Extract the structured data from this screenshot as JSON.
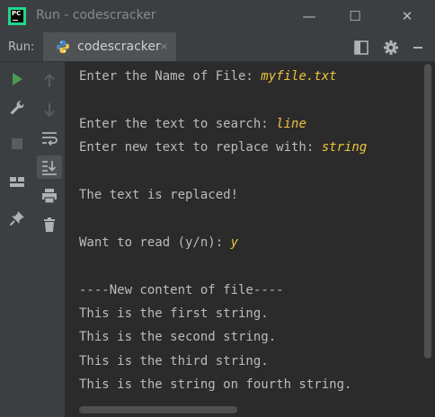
{
  "window": {
    "title": "Run - codescracker",
    "icon_text": "PC",
    "minimize": "—",
    "maximize": "☐",
    "close": "✕"
  },
  "run_panel": {
    "label": "Run:",
    "tab_label": "codescracker",
    "tab_close": "×"
  },
  "console": {
    "lines": [
      {
        "prompt": "Enter the Name of File: ",
        "input": "myfile.txt"
      },
      {
        "prompt": "",
        "input": ""
      },
      {
        "prompt": "Enter the text to search: ",
        "input": "line"
      },
      {
        "prompt": "Enter new text to replace with: ",
        "input": "string"
      },
      {
        "prompt": "",
        "input": ""
      },
      {
        "prompt": "The text is replaced!",
        "input": ""
      },
      {
        "prompt": "",
        "input": ""
      },
      {
        "prompt": "Want to read (y/n): ",
        "input": "y"
      },
      {
        "prompt": "",
        "input": ""
      },
      {
        "prompt": "----New content of file----",
        "input": ""
      },
      {
        "prompt": "This is the first string.",
        "input": ""
      },
      {
        "prompt": "This is the second string.",
        "input": ""
      },
      {
        "prompt": "This is the third string.",
        "input": ""
      },
      {
        "prompt": "This is the string on fourth string.",
        "input": ""
      }
    ]
  },
  "colors": {
    "run_green": "#499c54",
    "input_text": "#f0c33c",
    "console_bg": "#2b2b2b",
    "panel_bg": "#3c3f41"
  }
}
